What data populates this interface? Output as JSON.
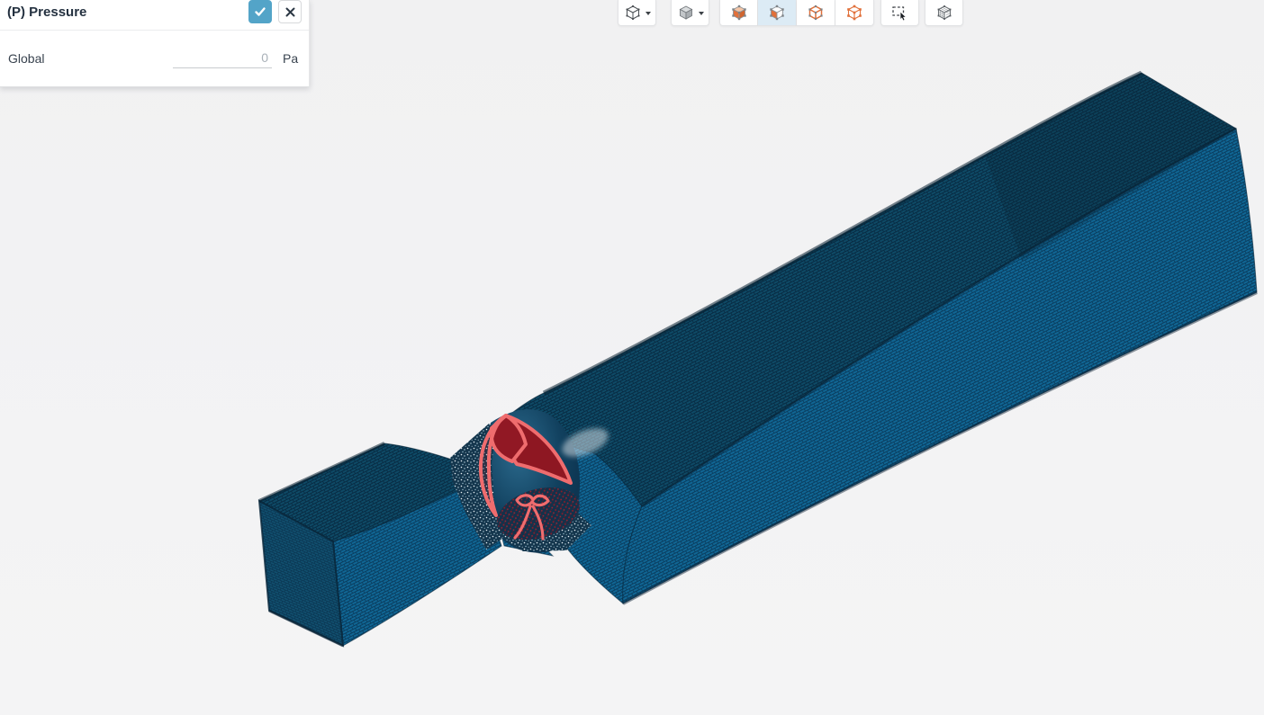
{
  "panel": {
    "title": "(P) Pressure",
    "apply_icon": "check-icon",
    "cancel_icon": "close-icon",
    "field": {
      "label": "Global",
      "value": "",
      "placeholder": "0",
      "unit": "Pa"
    }
  },
  "toolbar": {
    "buttons": [
      {
        "name": "view-cube-dropdown",
        "icon": "wireframe-cube-icon",
        "has_dropdown": true
      },
      {
        "name": "render-mode-dropdown",
        "icon": "shaded-cube-icon",
        "has_dropdown": true
      },
      {
        "name": "select-volumes",
        "icon": "volume-cube-icon",
        "active": false
      },
      {
        "name": "select-faces",
        "icon": "face-cube-icon",
        "active": true
      },
      {
        "name": "select-edges",
        "icon": "edge-cube-icon",
        "active": false
      },
      {
        "name": "select-nodes",
        "icon": "node-cube-icon",
        "active": false
      },
      {
        "name": "box-select",
        "icon": "marquee-cursor-icon",
        "active": false
      },
      {
        "name": "mesh-display",
        "icon": "mesh-cube-icon",
        "active": false
      }
    ]
  },
  "viewport": {
    "model": "meshed venturi duct with rotating-zone fan wireframe",
    "selected_zone": "fan MRF region"
  },
  "colors": {
    "accent_teal": "#53a4c8",
    "active_button_bg": "#dcebf5",
    "selection_orange": "#e1703a",
    "mesh_side_blue": "#106694",
    "mesh_top_blue": "#0e4a66",
    "fan_outline_red": "#ef6c6e",
    "fan_fill_dark_red": "#8e1722",
    "background": "#f3f3f4"
  }
}
